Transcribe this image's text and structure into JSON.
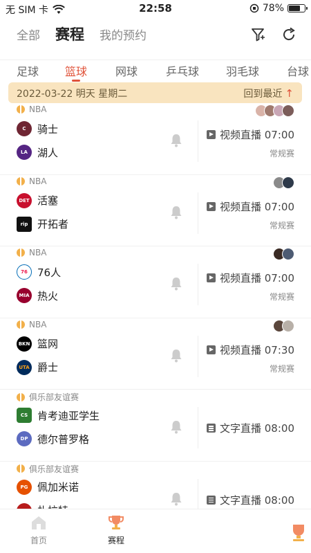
{
  "status_bar": {
    "carrier": "无 SIM 卡",
    "time": "22:58",
    "battery": "78%",
    "battery_level": 0.78
  },
  "top_tabs": [
    {
      "label": "全部",
      "active": false
    },
    {
      "label": "赛程",
      "active": true
    },
    {
      "label": "我的预约",
      "active": false
    }
  ],
  "top_icons": [
    "filter-icon",
    "refresh-icon"
  ],
  "sport_tabs": [
    {
      "label": "足球",
      "active": false
    },
    {
      "label": "篮球",
      "active": true
    },
    {
      "label": "网球",
      "active": false
    },
    {
      "label": "乒乓球",
      "active": false
    },
    {
      "label": "羽毛球",
      "active": false
    },
    {
      "label": "台球",
      "active": false
    }
  ],
  "date_banner": {
    "date": "2022-03-22 明天 星期二",
    "back_label": "回到最近",
    "back_icon": "arrow-up-icon"
  },
  "matches": [
    {
      "league": "NBA",
      "home": "骑士",
      "away": "湖人",
      "live": "视频直播 07:00",
      "stage": "常规赛",
      "live_type": "video"
    },
    {
      "league": "NBA",
      "home": "活塞",
      "away": "开拓者",
      "live": "视频直播 07:00",
      "stage": "常规赛",
      "live_type": "video"
    },
    {
      "league": "NBA",
      "home": "76人",
      "away": "热火",
      "live": "视频直播 07:00",
      "stage": "常规赛",
      "live_type": "video"
    },
    {
      "league": "NBA",
      "home": "篮网",
      "away": "爵士",
      "live": "视频直播 07:30",
      "stage": "常规赛",
      "live_type": "video"
    },
    {
      "league": "俱乐部友谊赛",
      "home": "肯考迪亚学生",
      "away": "德尔普罗格",
      "live": "文字直播 08:00",
      "stage": "",
      "live_type": "text"
    },
    {
      "league": "俱乐部友谊赛",
      "home": "佩加米诺",
      "away": "扎拉特",
      "live": "文字直播 08:00",
      "stage": "",
      "live_type": "text"
    }
  ],
  "bottom_nav": [
    {
      "label": "首页",
      "icon": "home-icon",
      "active": false
    },
    {
      "label": "赛程",
      "icon": "trophy-icon",
      "active": true
    }
  ],
  "colors": {
    "accent": "#e0533a",
    "banner": "#f9e4bf"
  }
}
